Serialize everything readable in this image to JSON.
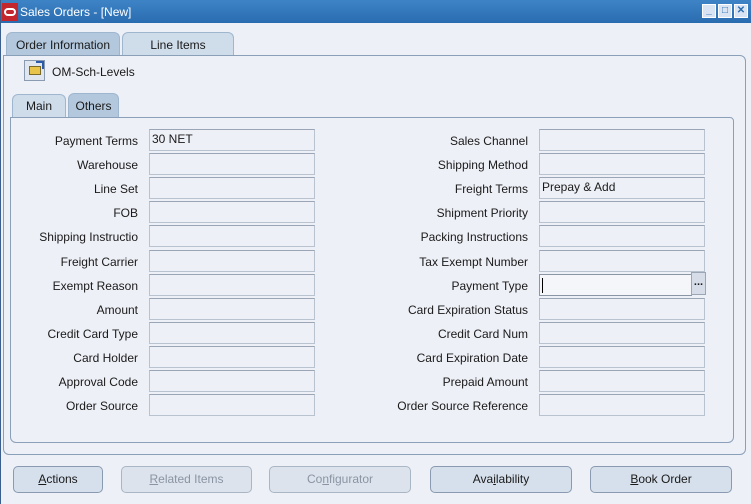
{
  "window": {
    "title": "Sales Orders - [New]",
    "controls": [
      "minimize",
      "maximize",
      "close"
    ]
  },
  "outer_tabs": [
    {
      "label": "Order Information",
      "active": true
    },
    {
      "label": "Line Items",
      "active": false
    }
  ],
  "toolbar": {
    "icon": "open-folder-icon",
    "label": "OM-Sch-Levels"
  },
  "inner_tabs": [
    {
      "label": "Main",
      "active": false
    },
    {
      "label": "Others",
      "active": true
    }
  ],
  "left_fields": [
    {
      "label": "Payment Terms",
      "value": "30 NET"
    },
    {
      "label": "Warehouse",
      "value": ""
    },
    {
      "label": "Line Set",
      "value": ""
    },
    {
      "label": "FOB",
      "value": ""
    },
    {
      "label": "Shipping Instructio",
      "value": ""
    },
    {
      "label": "Freight Carrier",
      "value": ""
    },
    {
      "label": "Exempt Reason",
      "value": ""
    },
    {
      "label": "Amount",
      "value": ""
    },
    {
      "label": "Credit Card Type",
      "value": ""
    },
    {
      "label": "Card Holder",
      "value": ""
    },
    {
      "label": "Approval Code",
      "value": ""
    },
    {
      "label": "Order Source",
      "value": ""
    }
  ],
  "right_fields": [
    {
      "label": "Sales Channel",
      "value": ""
    },
    {
      "label": "Shipping Method",
      "value": ""
    },
    {
      "label": "Freight Terms",
      "value": "Prepay & Add"
    },
    {
      "label": "Shipment Priority",
      "value": ""
    },
    {
      "label": "Packing Instructions",
      "value": ""
    },
    {
      "label": "Tax Exempt Number",
      "value": ""
    },
    {
      "label": "Payment Type",
      "value": ""
    },
    {
      "label": "Card Expiration Status",
      "value": ""
    },
    {
      "label": "Credit Card Num",
      "value": ""
    },
    {
      "label": "Card Expiration Date",
      "value": ""
    },
    {
      "label": "Prepaid Amount",
      "value": ""
    },
    {
      "label": "Order Source Reference",
      "value": ""
    }
  ],
  "lov_button": "...",
  "buttons": [
    {
      "label": "Actions",
      "mnemonic": "A",
      "enabled": true
    },
    {
      "label": "Related Items",
      "mnemonic": "R",
      "enabled": false
    },
    {
      "label": "Configurator",
      "mnemonic": "n",
      "enabled": false
    },
    {
      "label": "Availability",
      "mnemonic": "i",
      "enabled": true
    },
    {
      "label": "Book Order",
      "mnemonic": "B",
      "enabled": true
    }
  ]
}
